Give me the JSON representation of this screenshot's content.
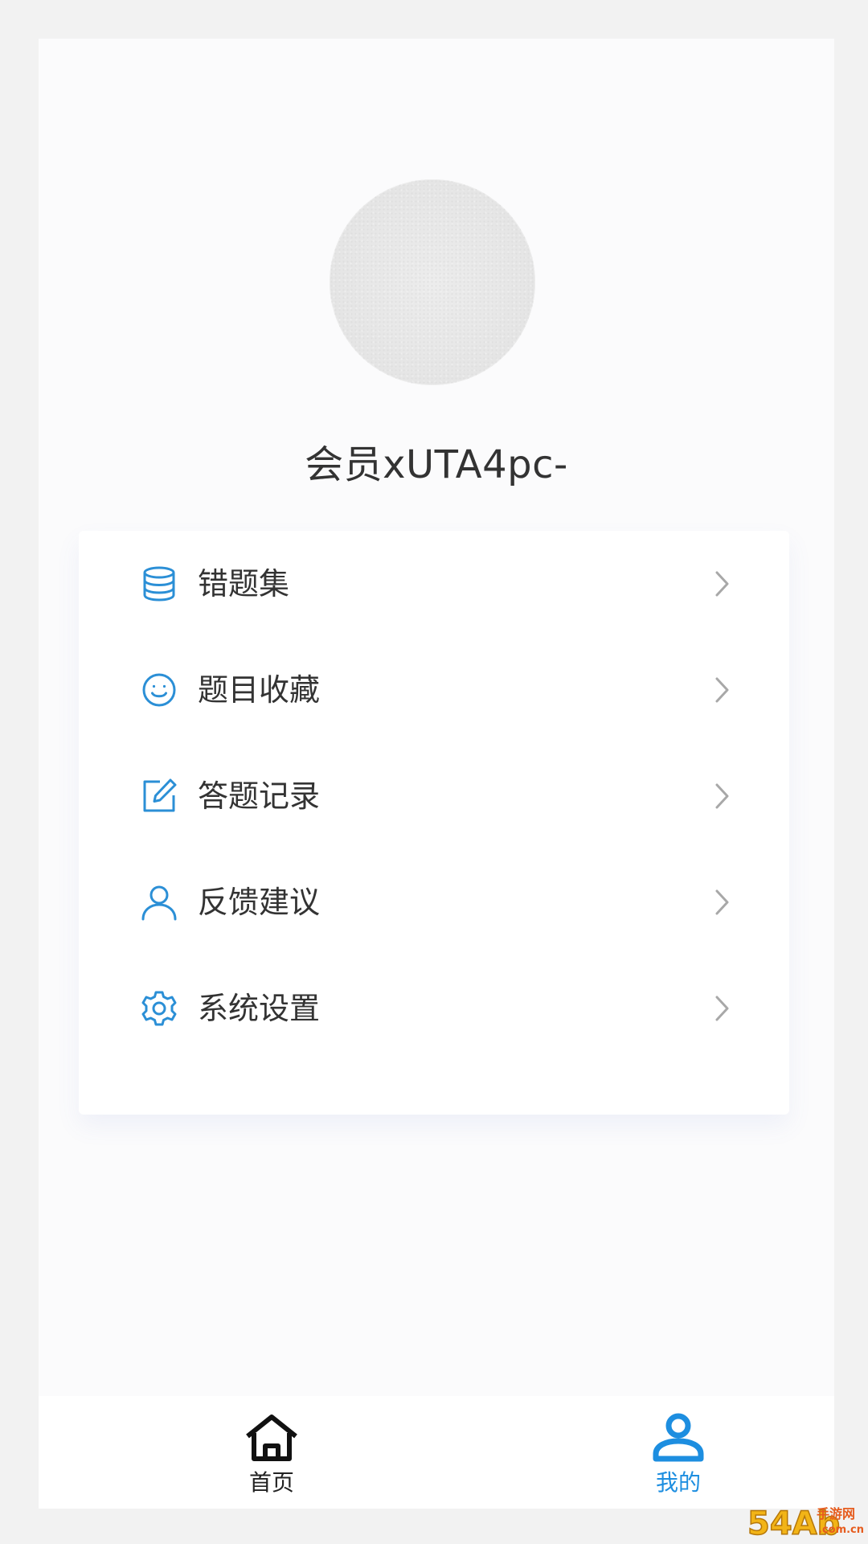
{
  "profile": {
    "username": "会员xUTA4pc-"
  },
  "menu": {
    "items": [
      {
        "label": "错题集",
        "icon": "database-icon"
      },
      {
        "label": "题目收藏",
        "icon": "smile-icon"
      },
      {
        "label": "答题记录",
        "icon": "edit-icon"
      },
      {
        "label": "反馈建议",
        "icon": "user-icon"
      },
      {
        "label": "系统设置",
        "icon": "gear-icon"
      }
    ]
  },
  "tabbar": {
    "items": [
      {
        "label": "首页",
        "icon": "home-icon",
        "active": false
      },
      {
        "label": "我的",
        "icon": "person-icon",
        "active": true
      }
    ]
  },
  "watermark": {
    "brand": "54Ab",
    "site_name": "手游网",
    "domain": ".com.cn"
  },
  "colors": {
    "accent": "#2b8fd6",
    "text": "#333333",
    "tab_inactive": "#222222",
    "chevron": "#a8a8a8"
  }
}
